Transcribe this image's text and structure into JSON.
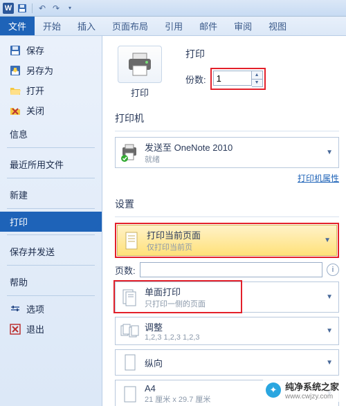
{
  "qat": {
    "undo_tip": "↶",
    "redo_tip": "↷"
  },
  "ribbon": {
    "file": "文件",
    "tabs": [
      "开始",
      "插入",
      "页面布局",
      "引用",
      "邮件",
      "审阅",
      "视图"
    ]
  },
  "sidebar": {
    "top": [
      {
        "icon": "save",
        "label": "保存"
      },
      {
        "icon": "saveas",
        "label": "另存为"
      },
      {
        "icon": "open",
        "label": "打开"
      },
      {
        "icon": "close",
        "label": "关闭"
      }
    ],
    "headings": [
      "信息",
      "最近所用文件",
      "新建",
      "打印",
      "保存并发送",
      "帮助"
    ],
    "bottom": [
      {
        "icon": "options",
        "label": "选项"
      },
      {
        "icon": "exit",
        "label": "退出"
      }
    ],
    "selected": "打印"
  },
  "print": {
    "button_label": "打印",
    "title": "打印",
    "copies_label": "份数:",
    "copies_value": "1"
  },
  "printer": {
    "section": "打印机",
    "name": "发送至 OneNote 2010",
    "status": "就绪",
    "props_link": "打印机属性"
  },
  "settings": {
    "section": "设置",
    "range": {
      "main": "打印当前页面",
      "sub": "仅打印当前页"
    },
    "pages_label": "页数:",
    "pages_value": "",
    "duplex": {
      "main": "单面打印",
      "sub": "只打印一侧的页面"
    },
    "collate": {
      "main": "调整",
      "sub": "1,2,3   1,2,3   1,2,3"
    },
    "orient": {
      "main": "纵向",
      "sub": ""
    },
    "paper": {
      "main": "A4",
      "sub": "21 厘米 x 29.7 厘米"
    }
  },
  "watermark": {
    "text": "纯净系统之家",
    "url": "www.cwjzy.com"
  }
}
